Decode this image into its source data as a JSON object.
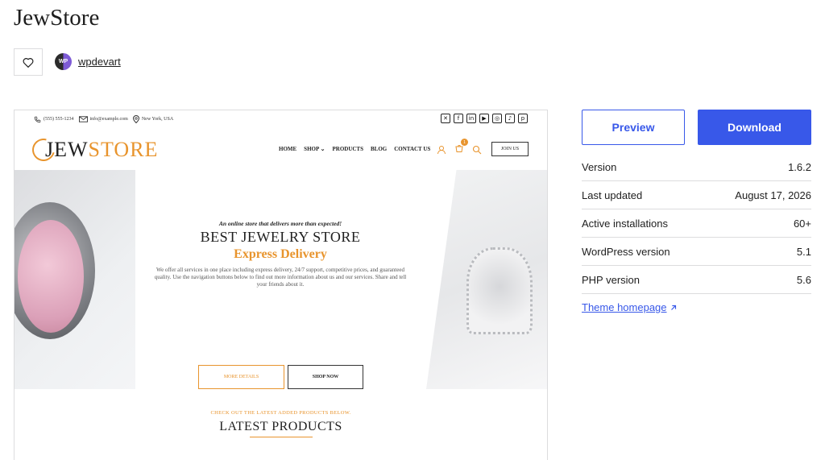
{
  "theme": {
    "title": "JewStore"
  },
  "author": {
    "avatar_text": "WP",
    "name": "wpdevart"
  },
  "screenshot": {
    "topbar": {
      "phone": "(555) 555-1234",
      "email": "info@example.com",
      "location": "New York, USA",
      "socials": [
        "x-icon",
        "facebook-icon",
        "linkedin-icon",
        "youtube-icon",
        "instagram-icon",
        "tiktok-icon",
        "pinterest-icon"
      ]
    },
    "logo": {
      "part1": "JEW",
      "part2": "STORE"
    },
    "menu": [
      "HOME",
      "SHOP",
      "PRODUCTS",
      "BLOG",
      "CONTACT US"
    ],
    "cart_count": "1",
    "join_label": "JOIN US",
    "hero": {
      "tagline": "An online store that delivers more than expected!",
      "title": "BEST JEWELRY STORE",
      "subtitle": "Express Delivery",
      "description": "We offer all services in one place including express delivery, 24/7 support, competitive prices, and guaranteed quality. Use the navigation buttons below to find out more information about us and our services. Share and tell your friends about it.",
      "more_label": "MORE DETAILS",
      "shop_label": "SHOP NOW"
    },
    "latest": {
      "kicker": "CHECK OUT THE LATEST ADDED PRODUCTS BELOW.",
      "title": "LATEST PRODUCTS"
    }
  },
  "actions": {
    "preview": "Preview",
    "download": "Download"
  },
  "meta": [
    {
      "label": "Version",
      "value": "1.6.2"
    },
    {
      "label": "Last updated",
      "value": "August 17, 2026"
    },
    {
      "label": "Active installations",
      "value": "60+"
    },
    {
      "label": "WordPress version",
      "value": "5.1"
    },
    {
      "label": "PHP version",
      "value": "5.6"
    }
  ],
  "homepage_link": "Theme homepage",
  "colors": {
    "accent": "#3858e9",
    "brand": "#e8942d"
  }
}
